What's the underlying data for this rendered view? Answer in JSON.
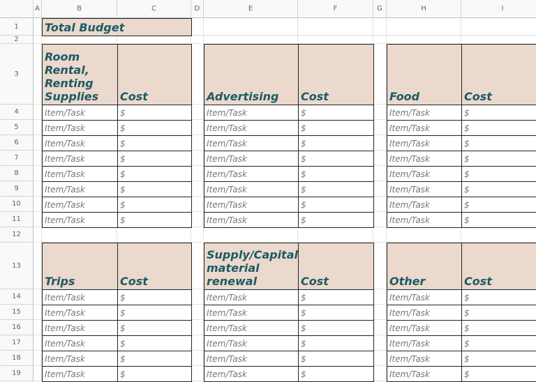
{
  "columns": [
    "A",
    "B",
    "C",
    "D",
    "E",
    "F",
    "G",
    "H",
    "I"
  ],
  "rows": [
    "1",
    "2",
    "3",
    "4",
    "5",
    "6",
    "7",
    "8",
    "9",
    "10",
    "11",
    "12",
    "13",
    "14",
    "15",
    "16",
    "17",
    "18",
    "19"
  ],
  "title": "Total Budget",
  "colors": {
    "header_fill": "#ead9cc",
    "header_text": "#1e5a66"
  },
  "sections": [
    {
      "name": "Room Rental, Renting Supplies",
      "cost": "Cost",
      "items": [
        [
          "Item/Task",
          "$"
        ],
        [
          "Item/Task",
          "$"
        ],
        [
          "Item/Task",
          "$"
        ],
        [
          "Item/Task",
          "$"
        ],
        [
          "Item/Task",
          "$"
        ],
        [
          "Item/Task",
          "$"
        ],
        [
          "Item/Task",
          "$"
        ],
        [
          "Item/Task",
          "$"
        ]
      ]
    },
    {
      "name": "Advertising",
      "cost": "Cost",
      "items": [
        [
          "Item/Task",
          "$"
        ],
        [
          "Item/Task",
          "$"
        ],
        [
          "Item/Task",
          "$"
        ],
        [
          "Item/Task",
          "$"
        ],
        [
          "Item/Task",
          "$"
        ],
        [
          "Item/Task",
          "$"
        ],
        [
          "Item/Task",
          "$"
        ],
        [
          "Item/Task",
          "$"
        ]
      ]
    },
    {
      "name": "Food",
      "cost": "Cost",
      "items": [
        [
          "Item/Task",
          "$"
        ],
        [
          "Item/Task",
          "$"
        ],
        [
          "Item/Task",
          "$"
        ],
        [
          "Item/Task",
          "$"
        ],
        [
          "Item/Task",
          "$"
        ],
        [
          "Item/Task",
          "$"
        ],
        [
          "Item/Task",
          "$"
        ],
        [
          "Item/Task",
          "$"
        ]
      ]
    },
    {
      "name": "Trips",
      "cost": "Cost",
      "items": [
        [
          "Item/Task",
          "$"
        ],
        [
          "Item/Task",
          "$"
        ],
        [
          "Item/Task",
          "$"
        ],
        [
          "Item/Task",
          "$"
        ],
        [
          "Item/Task",
          "$"
        ],
        [
          "Item/Task",
          "$"
        ]
      ]
    },
    {
      "name": "Supply/Capital material renewal",
      "cost": "Cost",
      "items": [
        [
          "Item/Task",
          "$"
        ],
        [
          "Item/Task",
          "$"
        ],
        [
          "Item/Task",
          "$"
        ],
        [
          "Item/Task",
          "$"
        ],
        [
          "Item/Task",
          "$"
        ],
        [
          "Item/Task",
          "$"
        ]
      ]
    },
    {
      "name": "Other",
      "cost": "Cost",
      "items": [
        [
          "Item/Task",
          "$"
        ],
        [
          "Item/Task",
          "$"
        ],
        [
          "Item/Task",
          "$"
        ],
        [
          "Item/Task",
          "$"
        ],
        [
          "Item/Task",
          "$"
        ],
        [
          "Item/Task",
          "$"
        ]
      ]
    }
  ]
}
